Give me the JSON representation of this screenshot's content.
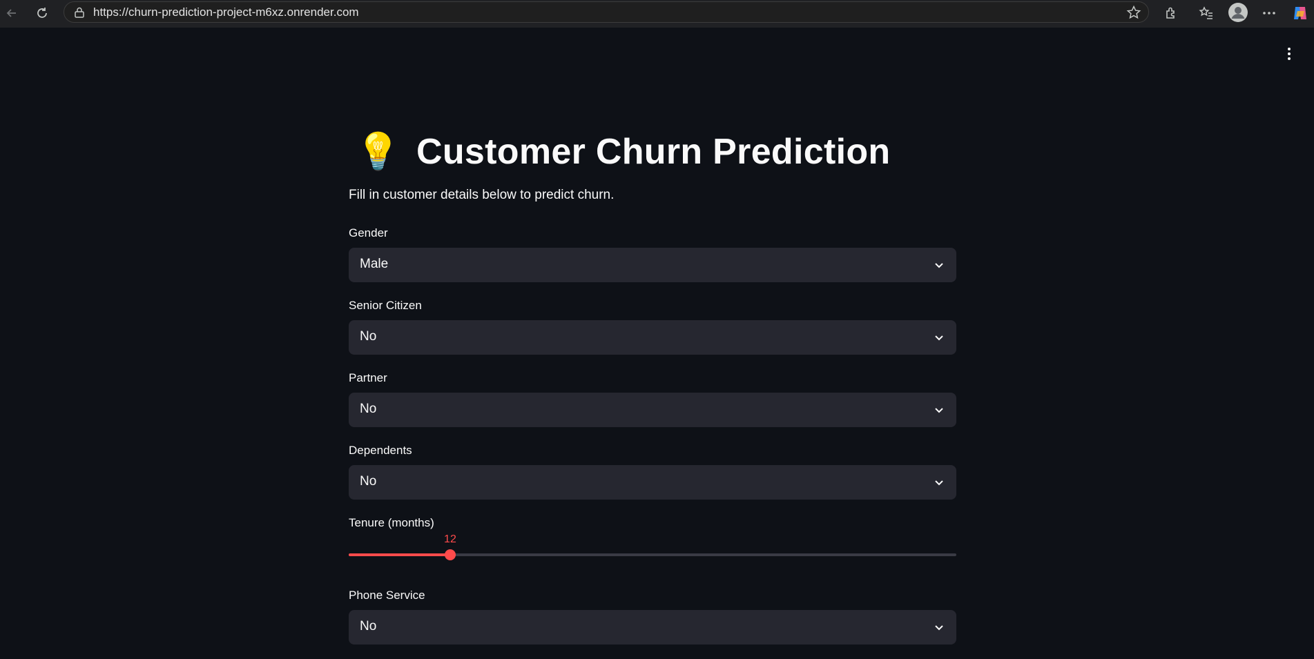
{
  "browser": {
    "url": "https://churn-prediction-project-m6xz.onrender.com"
  },
  "app": {
    "title_icon": "💡",
    "title": "Customer Churn Prediction",
    "subtitle": "Fill in customer details below to predict churn.",
    "fields": {
      "gender": {
        "label": "Gender",
        "value": "Male"
      },
      "senior": {
        "label": "Senior Citizen",
        "value": "No"
      },
      "partner": {
        "label": "Partner",
        "value": "No"
      },
      "dependents": {
        "label": "Dependents",
        "value": "No"
      },
      "tenure": {
        "label": "Tenure (months)",
        "value": "12",
        "fraction": 0.167
      },
      "phone": {
        "label": "Phone Service",
        "value": "No"
      }
    }
  },
  "colors": {
    "accent": "#ff4b4b",
    "background": "#0e1117",
    "input_bg": "#262730"
  }
}
